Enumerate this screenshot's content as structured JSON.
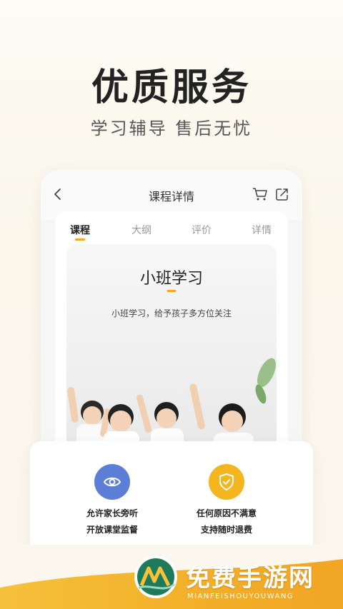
{
  "hero": {
    "title": "优质服务",
    "subtitle": "学习辅导 售后无忧"
  },
  "nav": {
    "title": "课程详情"
  },
  "tabs": [
    "课程",
    "大纲",
    "评价",
    "详情"
  ],
  "active_tab": 0,
  "banner": {
    "title": "小班学习",
    "description": "小班学习，给予孩子多方位关注"
  },
  "features": [
    {
      "icon": "eye-icon",
      "color": "#5b7fd6",
      "line1": "允许家长旁听",
      "line2": "开放课堂监督"
    },
    {
      "icon": "shield-check-icon",
      "color": "#f5b51e",
      "line1": "任何原因不满意",
      "line2": "支持随时退费"
    }
  ],
  "brand": {
    "name": "免费手游网",
    "pinyin": "MIANFEISHOUYOUWANG"
  },
  "colors": {
    "accent": "#f5a623",
    "footer": "#f3b12b"
  }
}
